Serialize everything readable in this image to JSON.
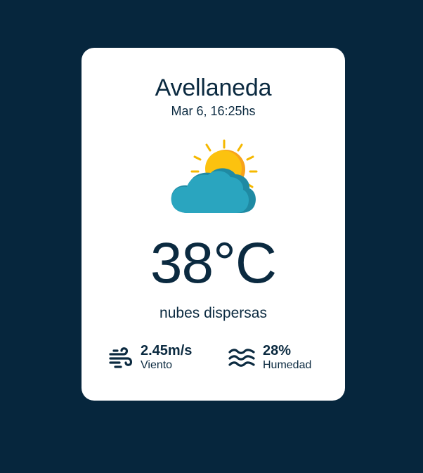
{
  "location": {
    "city": "Avellaneda",
    "datetime": "Mar 6, 16:25hs"
  },
  "current": {
    "temperature": "38°C",
    "description": "nubes dispersas",
    "icon": "sun-behind-cloud-icon"
  },
  "stats": {
    "wind": {
      "value": "2.45m/s",
      "label": "Viento",
      "icon": "wind-icon"
    },
    "humidity": {
      "value": "28%",
      "label": "Humedad",
      "icon": "waves-icon"
    }
  },
  "colors": {
    "background": "#06263d",
    "card": "#ffffff",
    "text": "#0b2a40",
    "sun": "#f5b800",
    "cloud": "#2aa5bf"
  }
}
